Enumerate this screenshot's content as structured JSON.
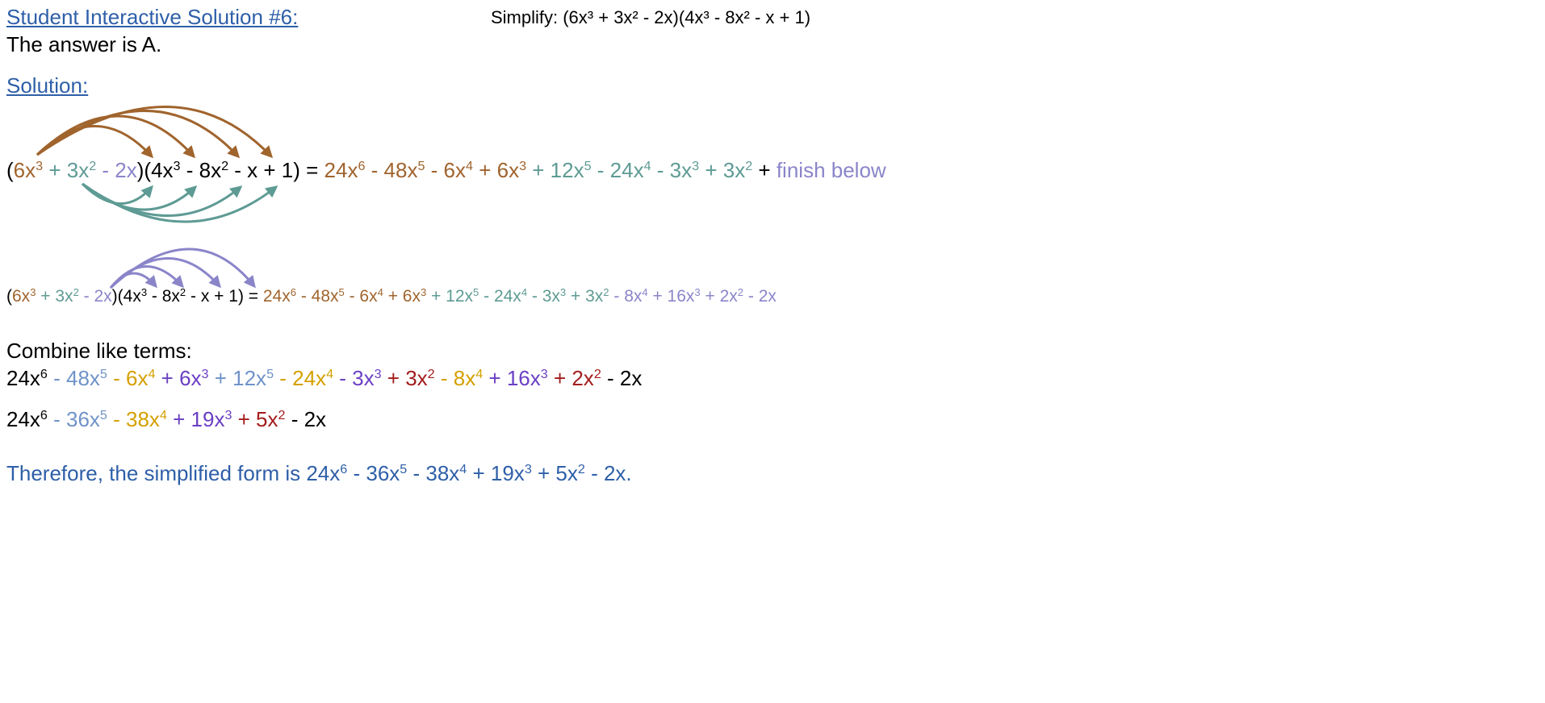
{
  "header": {
    "title": "Student Interactive Solution #6:",
    "answer": "The answer is A.",
    "problem": "Simplify:  (6x³ + 3x² - 2x)(4x³ - 8x² - x + 1)"
  },
  "solution_label": "Solution:",
  "step1": {
    "lhs": [
      {
        "t": "(",
        "c": "blk"
      },
      {
        "t": "6x",
        "s": "3",
        "c": "br"
      },
      {
        "t": " + 3x",
        "s": "2",
        "c": "tl"
      },
      {
        "t": " - 2x",
        "c": "pu"
      },
      {
        "t": ")(4x",
        "s": "3",
        "c": "blk"
      },
      {
        "t": " - 8x",
        "s": "2",
        "c": "blk"
      },
      {
        "t": " - x + 1) = ",
        "c": "blk"
      }
    ],
    "rhs": [
      {
        "t": "24x",
        "s": "6",
        "c": "br"
      },
      {
        "t": " - 48x",
        "s": "5",
        "c": "br"
      },
      {
        "t": " - 6x",
        "s": "4",
        "c": "br"
      },
      {
        "t": " + 6x",
        "s": "3",
        "c": "br"
      },
      {
        "t": " + 12x",
        "s": "5",
        "c": "tl"
      },
      {
        "t": " - 24x",
        "s": "4",
        "c": "tl"
      },
      {
        "t": " - 3x",
        "s": "3",
        "c": "tl"
      },
      {
        "t": " + 3x",
        "s": "2",
        "c": "tl"
      },
      {
        "t": " + ",
        "c": "blk"
      },
      {
        "t": "finish below",
        "c": "pu"
      }
    ]
  },
  "step2": {
    "lhs": [
      {
        "t": "(",
        "c": "blk"
      },
      {
        "t": "6x",
        "s": "3",
        "c": "br"
      },
      {
        "t": " + 3x",
        "s": "2",
        "c": "tl"
      },
      {
        "t": " - 2x",
        "c": "pu"
      },
      {
        "t": ")(4x",
        "s": "3",
        "c": "blk"
      },
      {
        "t": " - 8x",
        "s": "2",
        "c": "blk"
      },
      {
        "t": " - x + 1) = ",
        "c": "blk"
      }
    ],
    "rhs": [
      {
        "t": "24x",
        "s": "6",
        "c": "br"
      },
      {
        "t": " - 48x",
        "s": "5",
        "c": "br"
      },
      {
        "t": " - 6x",
        "s": "4",
        "c": "br"
      },
      {
        "t": " + 6x",
        "s": "3",
        "c": "br"
      },
      {
        "t": " + 12x",
        "s": "5",
        "c": "tl"
      },
      {
        "t": " - 24x",
        "s": "4",
        "c": "tl"
      },
      {
        "t": " - 3x",
        "s": "3",
        "c": "tl"
      },
      {
        "t": " + 3x",
        "s": "2",
        "c": "tl"
      },
      {
        "t": " - 8x",
        "s": "4",
        "c": "pu"
      },
      {
        "t": " + 16x",
        "s": "3",
        "c": "pu"
      },
      {
        "t": " + 2x",
        "s": "2",
        "c": "pu"
      },
      {
        "t": " - 2x",
        "c": "pu"
      }
    ]
  },
  "combine_label": "Combine like terms:",
  "combine_line1": [
    {
      "t": "24x",
      "s": "6",
      "c": "blk"
    },
    {
      "t": " - 48x",
      "s": "5",
      "c": "lb"
    },
    {
      "t": " - 6x",
      "s": "4",
      "c": "go"
    },
    {
      "t": " + 6x",
      "s": "3",
      "c": "vi"
    },
    {
      "t": " + 12x",
      "s": "5",
      "c": "lb"
    },
    {
      "t": " - 24x",
      "s": "4",
      "c": "go"
    },
    {
      "t": " - 3x",
      "s": "3",
      "c": "vi"
    },
    {
      "t": " + 3x",
      "s": "2",
      "c": "rd"
    },
    {
      "t": " - 8x",
      "s": "4",
      "c": "go"
    },
    {
      "t": " + 16x",
      "s": "3",
      "c": "vi"
    },
    {
      "t": " + 2x",
      "s": "2",
      "c": "rd"
    },
    {
      "t": " - 2x",
      "c": "blk"
    }
  ],
  "combine_line2": [
    {
      "t": "24x",
      "s": "6",
      "c": "blk"
    },
    {
      "t": " - 36x",
      "s": "5",
      "c": "lb"
    },
    {
      "t": " - 38x",
      "s": "4",
      "c": "go"
    },
    {
      "t": " + 19x",
      "s": "3",
      "c": "vi"
    },
    {
      "t": " + 5x",
      "s": "2",
      "c": "rd"
    },
    {
      "t": " - 2x",
      "c": "blk"
    }
  ],
  "conclusion": [
    {
      "t": "Therefore, the simplified form is 24x",
      "s": "6",
      "c": "db"
    },
    {
      "t": " - 36x",
      "s": "5",
      "c": "db"
    },
    {
      "t": " - 38x",
      "s": "4",
      "c": "db"
    },
    {
      "t": " + 19x",
      "s": "3",
      "c": "db"
    },
    {
      "t": " + 5x",
      "s": "2",
      "c": "db"
    },
    {
      "t": " - 2x.",
      "c": "db"
    }
  ],
  "colors": {
    "brown": "#a0642d",
    "teal": "#5e9b94",
    "purple": "#8a85c9",
    "light_blue": "#6f93c8",
    "gold": "#d4a000",
    "violet": "#6a3fc4",
    "red": "#a31c1c",
    "dark_blue": "#2e5fa8"
  }
}
